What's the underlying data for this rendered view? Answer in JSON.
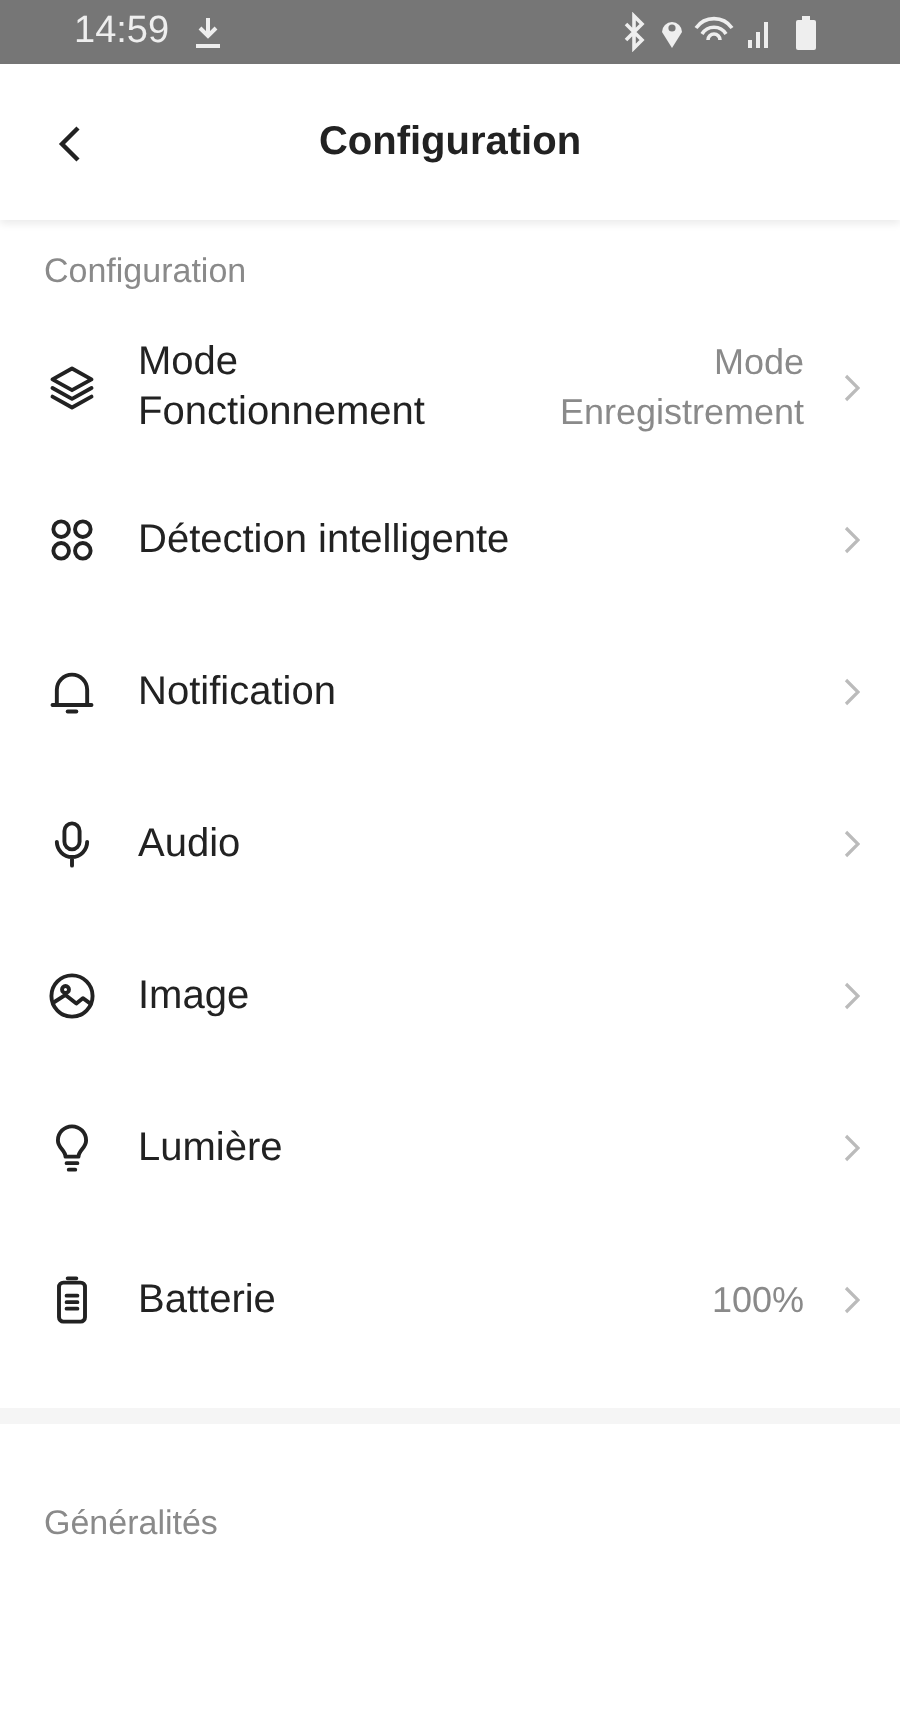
{
  "status_bar": {
    "time": "14:59"
  },
  "header": {
    "title": "Configuration"
  },
  "sections": [
    {
      "title": "Configuration",
      "items": [
        {
          "kind": "layers",
          "label": "Mode Fonctionnement",
          "value": "Mode Enregistrement"
        },
        {
          "kind": "grid",
          "label": "Détection intelligente"
        },
        {
          "kind": "bell",
          "label": "Notification"
        },
        {
          "kind": "mic",
          "label": "Audio"
        },
        {
          "kind": "image",
          "label": "Image"
        },
        {
          "kind": "bulb",
          "label": "Lumière"
        },
        {
          "kind": "battery",
          "label": "Batterie",
          "value": "100%"
        }
      ]
    },
    {
      "title": "Généralités"
    }
  ]
}
